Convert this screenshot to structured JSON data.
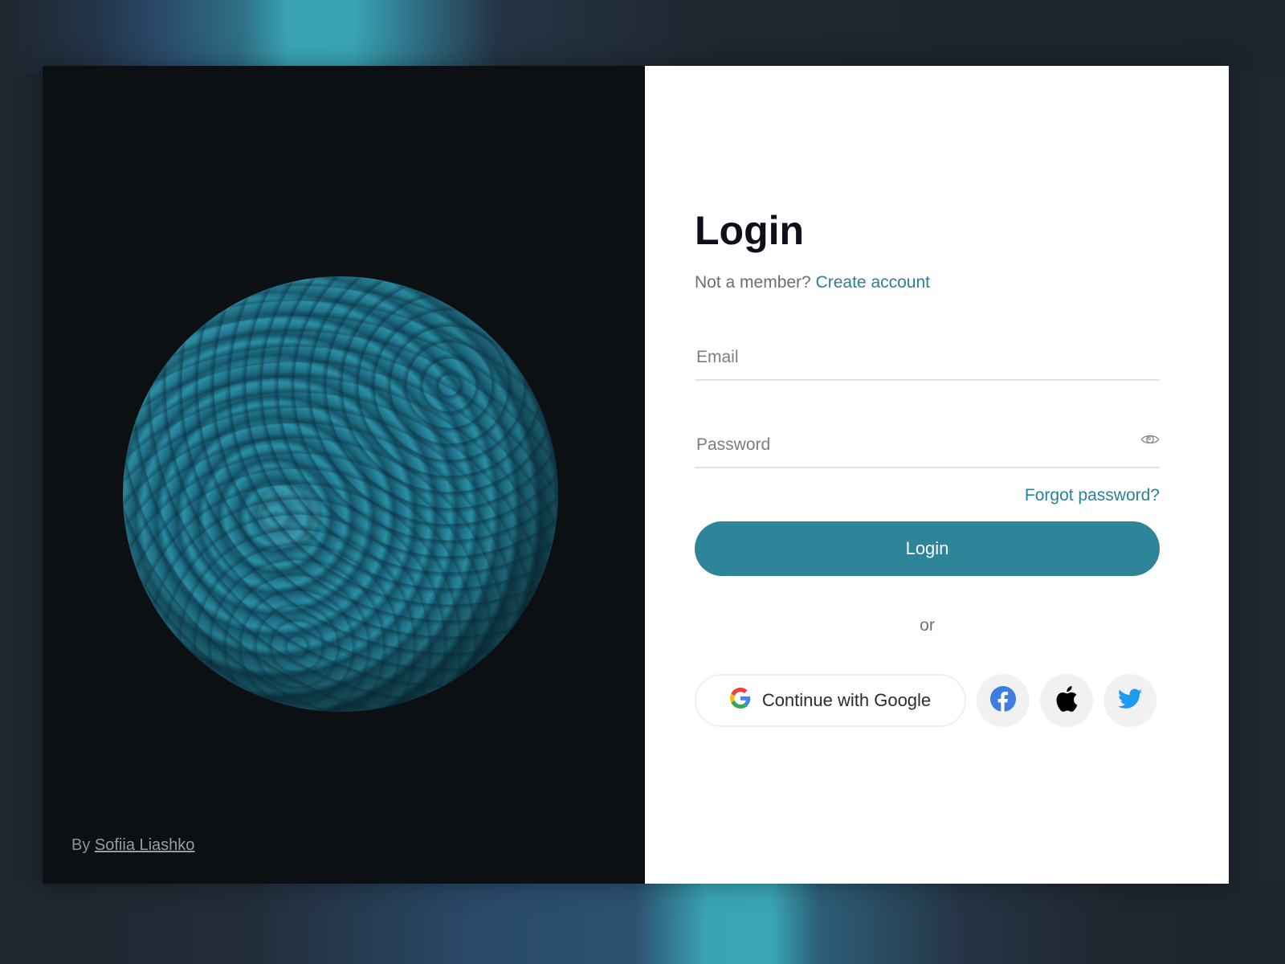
{
  "art": {
    "credit_prefix": "By",
    "credit_author": "Sofiia Liashko"
  },
  "form": {
    "title": "Login",
    "subtitle_text": "Not a member?",
    "create_account_label": "Create account",
    "email_placeholder": "Email",
    "email_value": "",
    "password_placeholder": "Password",
    "password_value": "",
    "forgot_password_label": "Forgot password?",
    "login_button_label": "Login",
    "divider_text": "or",
    "google_button_label": "Continue with Google"
  },
  "social": [
    {
      "name": "facebook",
      "icon": "facebook-icon",
      "color": "#3b7de0"
    },
    {
      "name": "apple",
      "icon": "apple-icon",
      "color": "#000000"
    },
    {
      "name": "twitter",
      "icon": "twitter-icon",
      "color": "#1d9bf0"
    }
  ],
  "colors": {
    "accent": "#2e8499",
    "link": "#2a8097",
    "art_background": "#0c1013",
    "page_background": "#1f262e"
  }
}
